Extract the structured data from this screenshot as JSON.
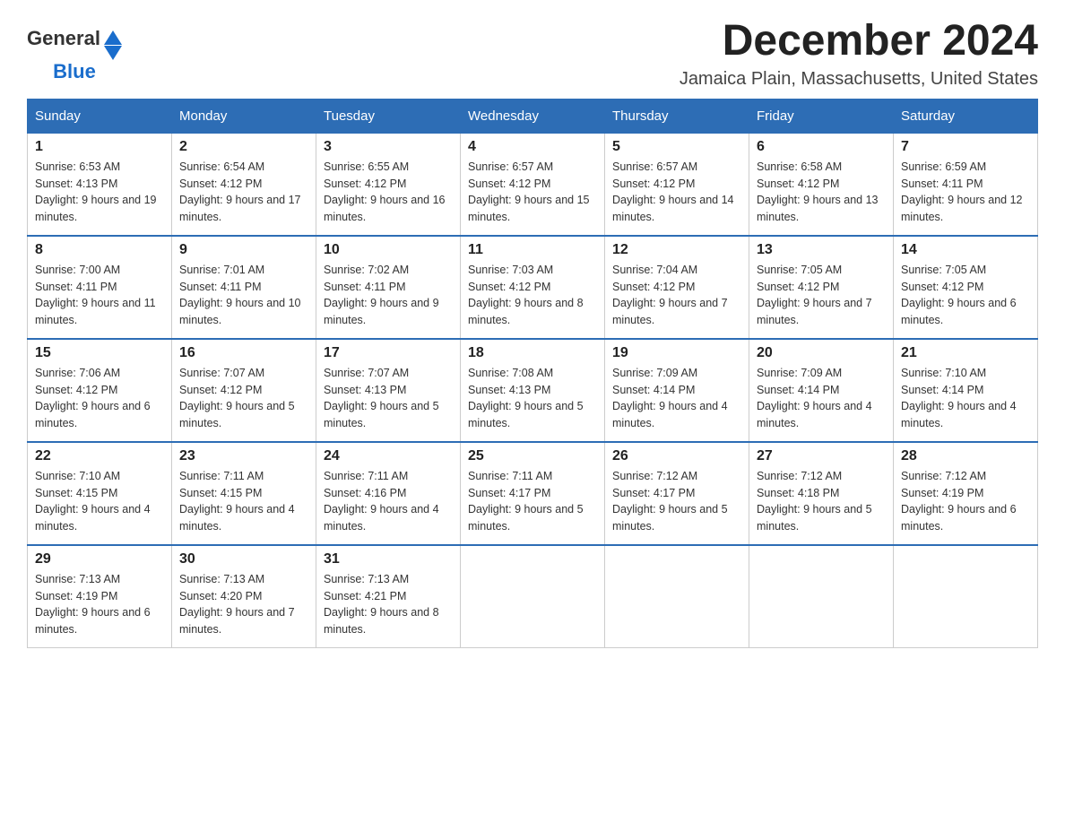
{
  "header": {
    "logo_general": "General",
    "logo_blue": "Blue",
    "month_title": "December 2024",
    "location": "Jamaica Plain, Massachusetts, United States"
  },
  "weekdays": [
    "Sunday",
    "Monday",
    "Tuesday",
    "Wednesday",
    "Thursday",
    "Friday",
    "Saturday"
  ],
  "weeks": [
    [
      {
        "day": "1",
        "sunrise": "6:53 AM",
        "sunset": "4:13 PM",
        "daylight": "9 hours and 19 minutes."
      },
      {
        "day": "2",
        "sunrise": "6:54 AM",
        "sunset": "4:12 PM",
        "daylight": "9 hours and 17 minutes."
      },
      {
        "day": "3",
        "sunrise": "6:55 AM",
        "sunset": "4:12 PM",
        "daylight": "9 hours and 16 minutes."
      },
      {
        "day": "4",
        "sunrise": "6:57 AM",
        "sunset": "4:12 PM",
        "daylight": "9 hours and 15 minutes."
      },
      {
        "day": "5",
        "sunrise": "6:57 AM",
        "sunset": "4:12 PM",
        "daylight": "9 hours and 14 minutes."
      },
      {
        "day": "6",
        "sunrise": "6:58 AM",
        "sunset": "4:12 PM",
        "daylight": "9 hours and 13 minutes."
      },
      {
        "day": "7",
        "sunrise": "6:59 AM",
        "sunset": "4:11 PM",
        "daylight": "9 hours and 12 minutes."
      }
    ],
    [
      {
        "day": "8",
        "sunrise": "7:00 AM",
        "sunset": "4:11 PM",
        "daylight": "9 hours and 11 minutes."
      },
      {
        "day": "9",
        "sunrise": "7:01 AM",
        "sunset": "4:11 PM",
        "daylight": "9 hours and 10 minutes."
      },
      {
        "day": "10",
        "sunrise": "7:02 AM",
        "sunset": "4:11 PM",
        "daylight": "9 hours and 9 minutes."
      },
      {
        "day": "11",
        "sunrise": "7:03 AM",
        "sunset": "4:12 PM",
        "daylight": "9 hours and 8 minutes."
      },
      {
        "day": "12",
        "sunrise": "7:04 AM",
        "sunset": "4:12 PM",
        "daylight": "9 hours and 7 minutes."
      },
      {
        "day": "13",
        "sunrise": "7:05 AM",
        "sunset": "4:12 PM",
        "daylight": "9 hours and 7 minutes."
      },
      {
        "day": "14",
        "sunrise": "7:05 AM",
        "sunset": "4:12 PM",
        "daylight": "9 hours and 6 minutes."
      }
    ],
    [
      {
        "day": "15",
        "sunrise": "7:06 AM",
        "sunset": "4:12 PM",
        "daylight": "9 hours and 6 minutes."
      },
      {
        "day": "16",
        "sunrise": "7:07 AM",
        "sunset": "4:12 PM",
        "daylight": "9 hours and 5 minutes."
      },
      {
        "day": "17",
        "sunrise": "7:07 AM",
        "sunset": "4:13 PM",
        "daylight": "9 hours and 5 minutes."
      },
      {
        "day": "18",
        "sunrise": "7:08 AM",
        "sunset": "4:13 PM",
        "daylight": "9 hours and 5 minutes."
      },
      {
        "day": "19",
        "sunrise": "7:09 AM",
        "sunset": "4:14 PM",
        "daylight": "9 hours and 4 minutes."
      },
      {
        "day": "20",
        "sunrise": "7:09 AM",
        "sunset": "4:14 PM",
        "daylight": "9 hours and 4 minutes."
      },
      {
        "day": "21",
        "sunrise": "7:10 AM",
        "sunset": "4:14 PM",
        "daylight": "9 hours and 4 minutes."
      }
    ],
    [
      {
        "day": "22",
        "sunrise": "7:10 AM",
        "sunset": "4:15 PM",
        "daylight": "9 hours and 4 minutes."
      },
      {
        "day": "23",
        "sunrise": "7:11 AM",
        "sunset": "4:15 PM",
        "daylight": "9 hours and 4 minutes."
      },
      {
        "day": "24",
        "sunrise": "7:11 AM",
        "sunset": "4:16 PM",
        "daylight": "9 hours and 4 minutes."
      },
      {
        "day": "25",
        "sunrise": "7:11 AM",
        "sunset": "4:17 PM",
        "daylight": "9 hours and 5 minutes."
      },
      {
        "day": "26",
        "sunrise": "7:12 AM",
        "sunset": "4:17 PM",
        "daylight": "9 hours and 5 minutes."
      },
      {
        "day": "27",
        "sunrise": "7:12 AM",
        "sunset": "4:18 PM",
        "daylight": "9 hours and 5 minutes."
      },
      {
        "day": "28",
        "sunrise": "7:12 AM",
        "sunset": "4:19 PM",
        "daylight": "9 hours and 6 minutes."
      }
    ],
    [
      {
        "day": "29",
        "sunrise": "7:13 AM",
        "sunset": "4:19 PM",
        "daylight": "9 hours and 6 minutes."
      },
      {
        "day": "30",
        "sunrise": "7:13 AM",
        "sunset": "4:20 PM",
        "daylight": "9 hours and 7 minutes."
      },
      {
        "day": "31",
        "sunrise": "7:13 AM",
        "sunset": "4:21 PM",
        "daylight": "9 hours and 8 minutes."
      },
      null,
      null,
      null,
      null
    ]
  ]
}
